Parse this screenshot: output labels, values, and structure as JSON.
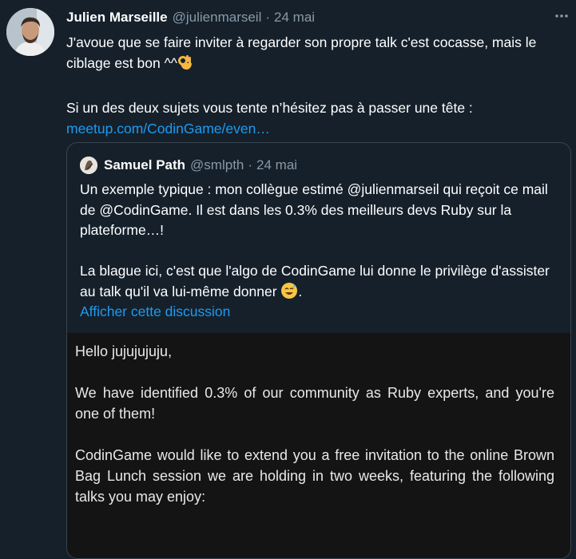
{
  "tweet": {
    "author_name": "Julien Marseille",
    "handle": "@julienmarseil",
    "separator": "·",
    "date": "24 mai",
    "line1": "J'avoue que se faire inviter à regarder son propre talk c'est cocasse, mais le ciblage est bon ^^",
    "line2": "Si un des deux sujets vous tente n’hésitez pas à passer une tête :",
    "link": "meetup.com/CodinGame/even…",
    "emoji_1": "ok-hand-emoji",
    "more_icon": "more-dots-icon"
  },
  "quote": {
    "author_name": "Samuel Path",
    "handle": "@smlpth",
    "separator": "·",
    "date": "24 mai",
    "para1": "Un exemple typique : mon collègue estimé @julienmarseil qui reçoit ce mail de @CodinGame. Il est dans les 0.3% des meilleurs devs Ruby sur la plateforme…!",
    "para2": "La blague ici, c'est que l'algo de CodinGame lui donne le privilège d'assister au talk qu'il va lui-même donner",
    "emoji_2": "sweat-smile-emoji",
    "para2_end": ".",
    "show_thread": "Afficher cette discussion"
  },
  "mail_image": {
    "greeting": "Hello jujujujuju,",
    "para1": "We have identified 0.3% of our community as Ruby experts, and you're one of them!",
    "para2": "CodinGame would like to extend you a free invitation to the online Brown Bag Lunch session we are holding in two weeks, featuring the following talks you may enjoy:"
  },
  "colors": {
    "background": "#15202b",
    "text": "#ffffff",
    "secondary": "#8899a6",
    "link": "#1d9bf0",
    "border": "#38444d"
  }
}
